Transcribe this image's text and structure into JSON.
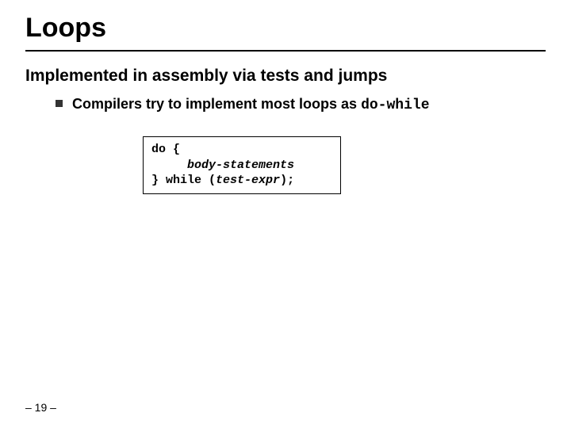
{
  "title": "Loops",
  "subhead": "Implemented in assembly via tests and jumps",
  "bullet": {
    "lead": "Compilers try to implement most loops as ",
    "code": "do-while"
  },
  "code_box": {
    "l1a": "do ",
    "l1b": "{",
    "l2": "body-statements",
    "l3a": "} ",
    "l3b": "while ",
    "l3c": "(",
    "l3d": "test-expr",
    "l3e": ");"
  },
  "pagenum": "– 19 –"
}
